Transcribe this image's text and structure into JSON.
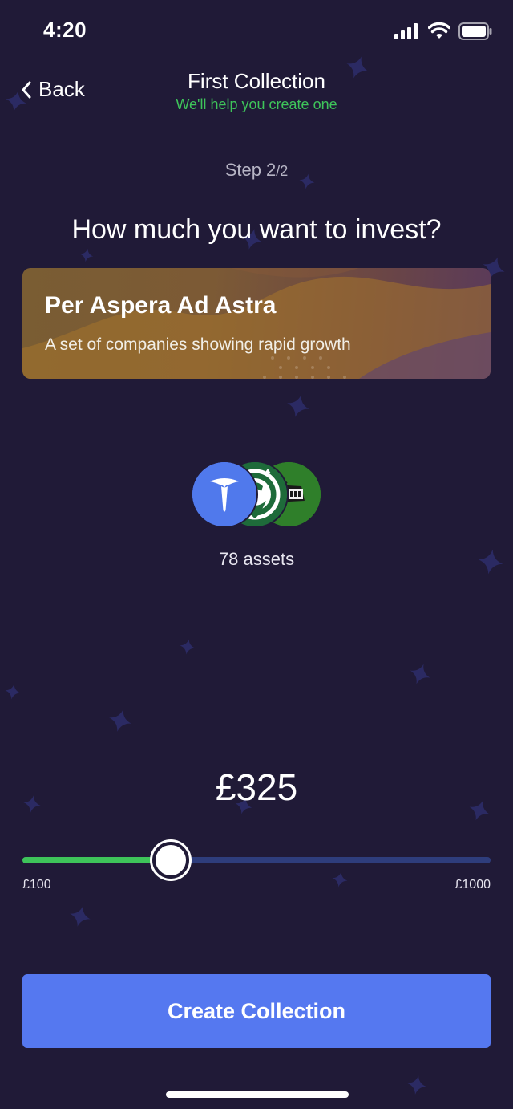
{
  "status_bar": {
    "time": "4:20",
    "icons": [
      "cellular-signal-icon",
      "wifi-icon",
      "battery-icon"
    ]
  },
  "nav": {
    "back_label": "Back",
    "back_icon": "chevron-left-icon",
    "title": "First Collection",
    "subtitle": "We'll help you create one"
  },
  "step": {
    "label": "Step 2",
    "total": "/2"
  },
  "question": "How much you want to invest?",
  "collection": {
    "title": "Per Aspera Ad Astra",
    "description": "A set of companies showing rapid growth",
    "logos": [
      "tesla-logo",
      "starbucks-logo",
      "yorks-logo"
    ],
    "assets_count": "78 assets"
  },
  "investment": {
    "amount": "£325",
    "slider_min_label": "£100",
    "slider_max_label": "£1000",
    "slider_value_fraction": 0.31
  },
  "actions": {
    "create_label": "Create Collection"
  },
  "colors": {
    "background": "#201a37",
    "accent_green": "#3ec45a",
    "primary_button": "#5578f0",
    "slider_track": "#2e3d7c",
    "tesla_blue": "#5079ec",
    "starbucks_green": "#1e6b3a",
    "yorks_green": "#2f7f2a"
  }
}
